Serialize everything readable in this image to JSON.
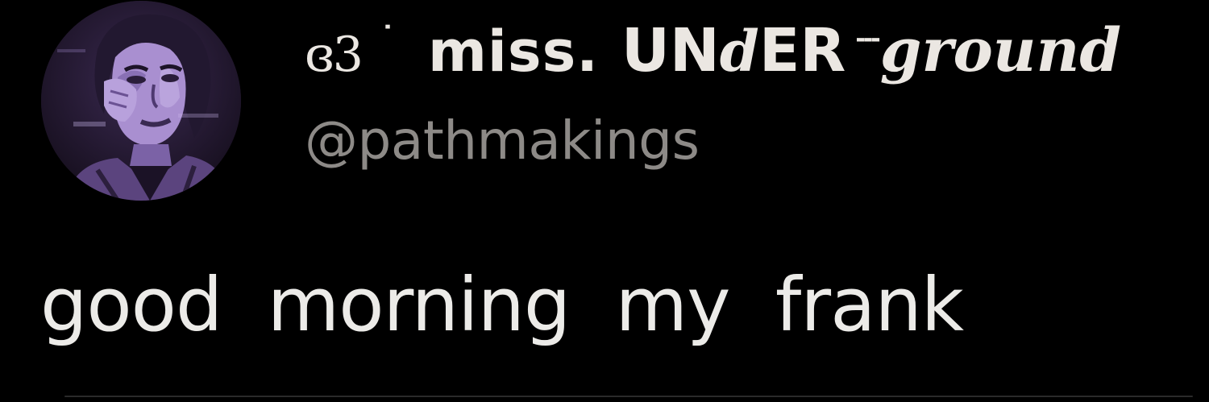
{
  "author": {
    "name_prefix_glyph": "ɞ3",
    "name_separator": "˙",
    "name_miss": "miss.",
    "name_under_a": "UN",
    "name_under_d": "d",
    "name_under_b": "ER",
    "name_dashes": "---",
    "name_ground": "ground",
    "handle": "@pathmakings",
    "avatar_icon": "profile-photo-purple-tint"
  },
  "tweet": {
    "text": "good morning my frank"
  },
  "colors": {
    "background": "#000000",
    "name_text": "#ebe7e2",
    "handle_text": "#8d8a87",
    "body_text": "#ecebe8",
    "avatar_tint": "#9a7fc4"
  }
}
